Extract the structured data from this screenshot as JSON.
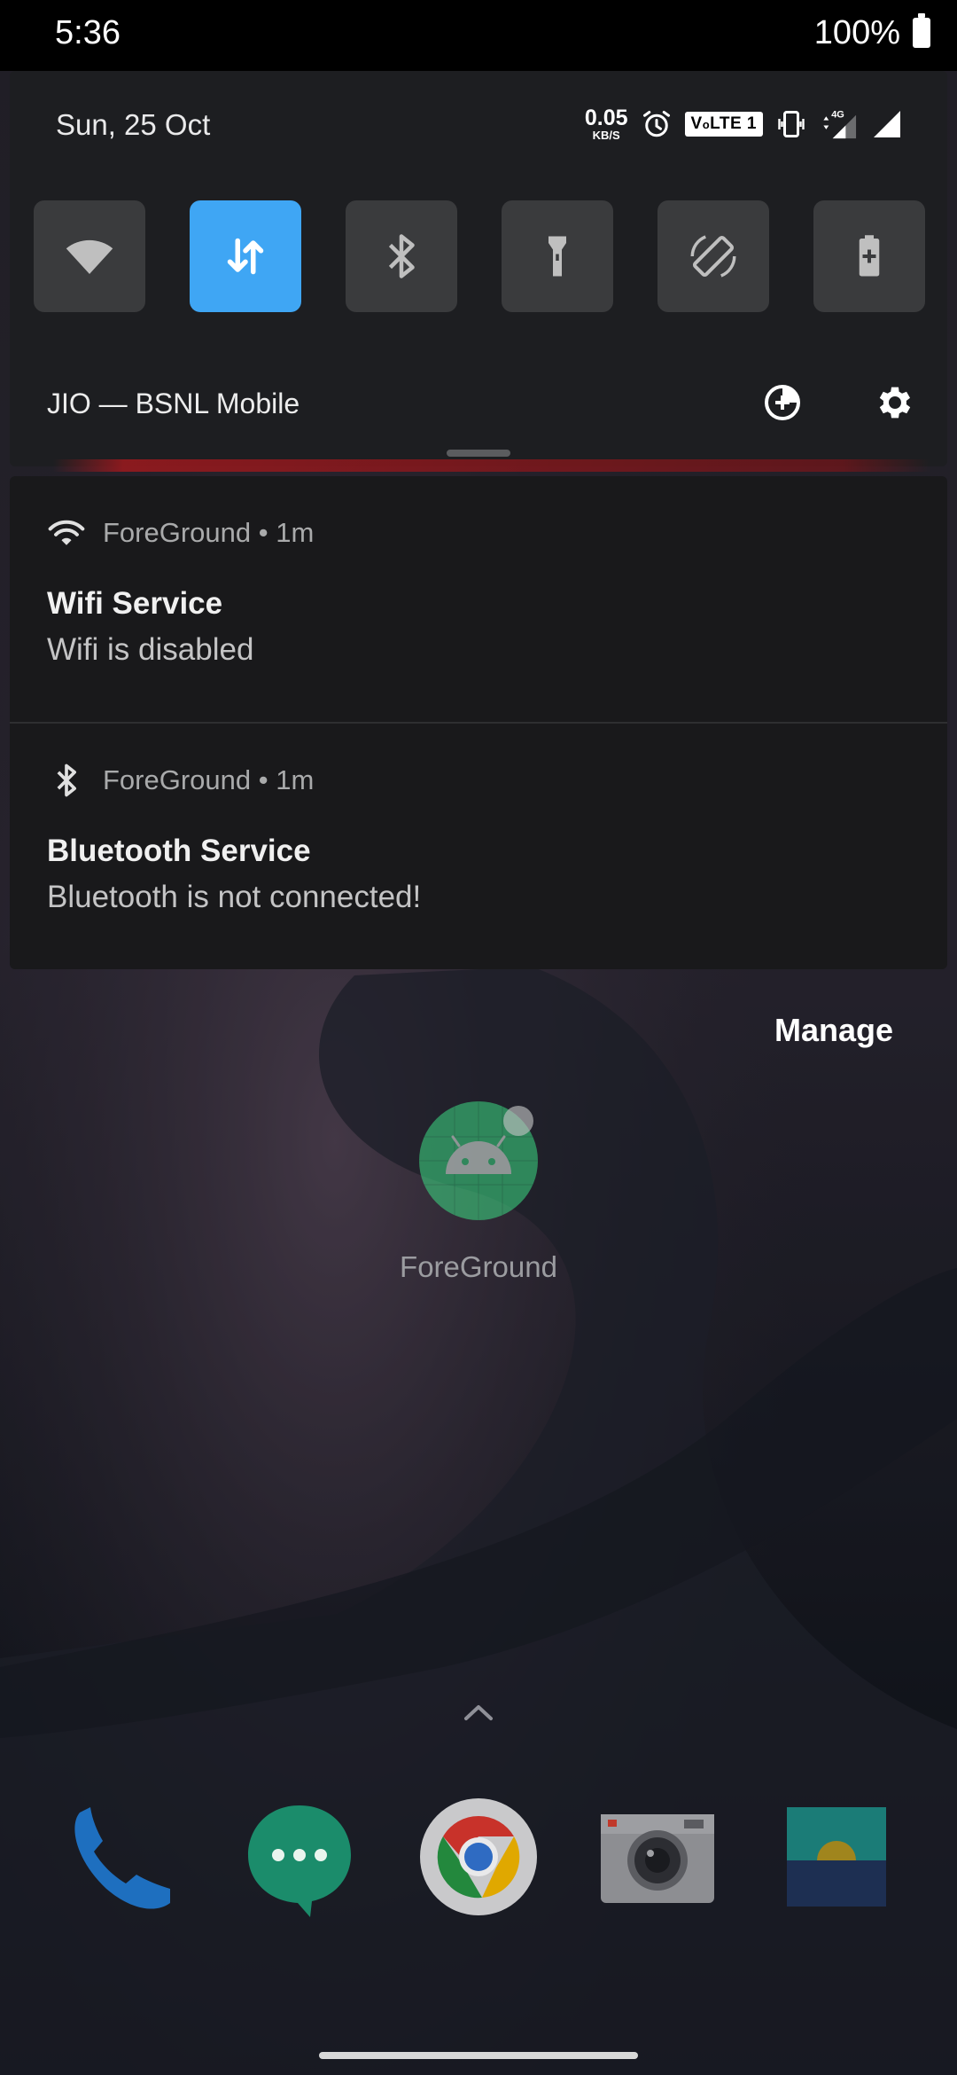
{
  "status_bar": {
    "time": "5:36",
    "battery": "100%"
  },
  "quick_settings": {
    "date": "Sun, 25 Oct",
    "net_speed_value": "0.05",
    "net_speed_unit": "KB/S",
    "volte_label": "V₀LTE 1",
    "network_type": "4G",
    "tiles": [
      {
        "name": "wifi",
        "icon": "wifi-icon",
        "active": false
      },
      {
        "name": "mobile-data",
        "icon": "data-arrows-icon",
        "active": true
      },
      {
        "name": "bluetooth",
        "icon": "bluetooth-icon",
        "active": false
      },
      {
        "name": "flashlight",
        "icon": "flashlight-icon",
        "active": false
      },
      {
        "name": "auto-rotate",
        "icon": "rotate-icon",
        "active": false
      },
      {
        "name": "battery-saver",
        "icon": "battery-plus-icon",
        "active": false
      }
    ],
    "carrier": "JIO — BSNL Mobile",
    "accent_color": "#3fa6f4"
  },
  "notifications": [
    {
      "app": "ForeGround",
      "time": "1m",
      "icon": "wifi-icon",
      "title": "Wifi Service",
      "text": "Wifi is disabled"
    },
    {
      "app": "ForeGround",
      "time": "1m",
      "icon": "bluetooth-icon",
      "title": "Bluetooth Service",
      "text": "Bluetooth is not connected!"
    }
  ],
  "manage_label": "Manage",
  "home": {
    "app_label": "ForeGround",
    "dock": [
      "phone-icon",
      "messages-icon",
      "chrome-icon",
      "camera-icon",
      "gallery-icon"
    ]
  }
}
